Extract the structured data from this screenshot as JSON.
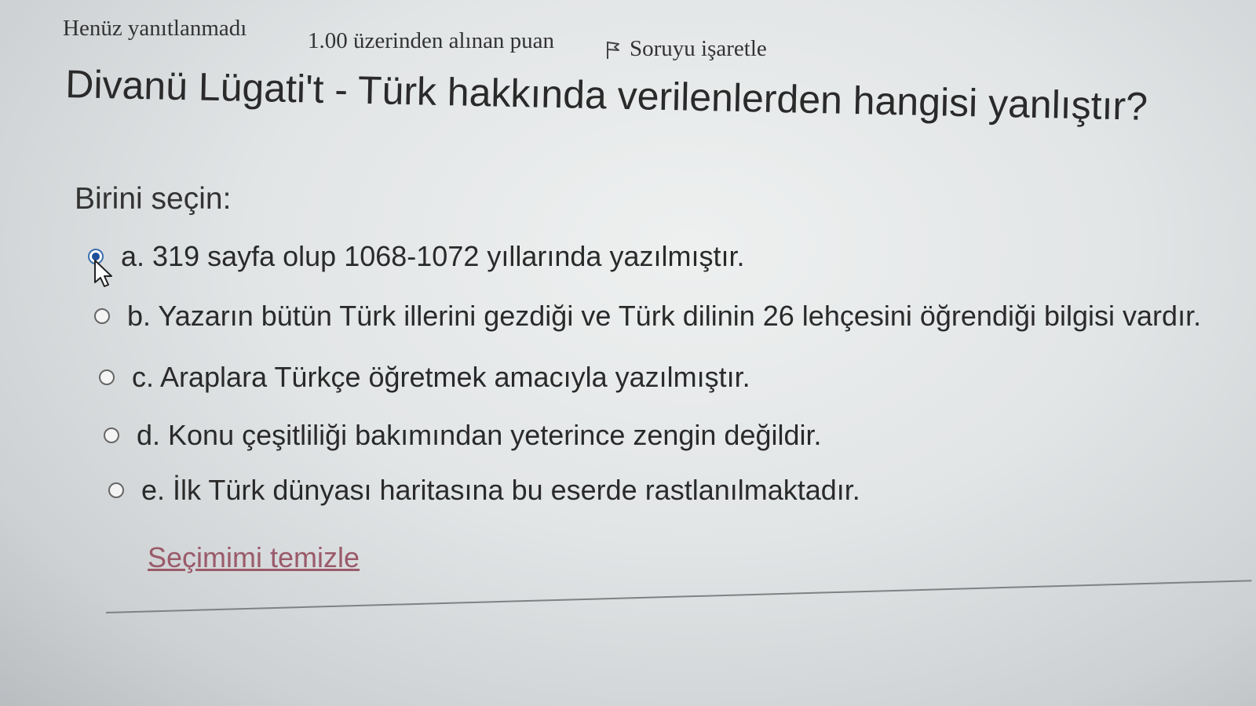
{
  "question_info": {
    "status": "Henüz yanıtlanmadı",
    "points": "1.00 üzerinden alınan puan",
    "flag_label": "Soruyu işaretle"
  },
  "question": {
    "text": "Divanü Lügati't - Türk hakkında verilenlerden hangisi yanlıştır?",
    "prompt": "Birini seçin:",
    "options": [
      {
        "label": "a. 319 sayfa olup 1068-1072 yıllarında yazılmıştır.",
        "selected": true
      },
      {
        "label": "b. Yazarın bütün Türk illerini gezdiği ve Türk dilinin 26 lehçesini öğrendiği bilgisi vardır.",
        "selected": false
      },
      {
        "label": "c. Araplara Türkçe öğretmek amacıyla yazılmıştır.",
        "selected": false
      },
      {
        "label": "d. Konu çeşitliliği bakımından yeterince zengin değildir.",
        "selected": false
      },
      {
        "label": "e. İlk Türk dünyası haritasına bu eserde rastlanılmaktadır.",
        "selected": false
      }
    ],
    "clear_label": "Seçimimi temizle"
  },
  "icons": {
    "flag": "flag-icon",
    "cursor": "mouse-pointer-icon"
  },
  "colors": {
    "selected_radio": "#1d4f9a",
    "link": "#9a5a6a"
  }
}
